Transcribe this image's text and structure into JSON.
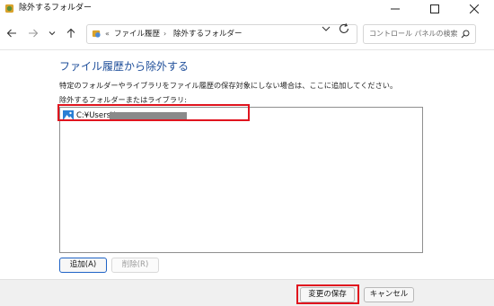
{
  "window": {
    "title": "除外するフォルダー",
    "controls": [
      "minimize-icon",
      "maximize-icon",
      "close-icon"
    ]
  },
  "addressbar": {
    "breadcrumb_overflow": "«",
    "crumbs": [
      "ファイル履歴",
      "除外するフォルダー"
    ],
    "separator": "›",
    "search_placeholder": "コントロール パネルの検索"
  },
  "main": {
    "heading": "ファイル履歴から除外する",
    "description": "特定のフォルダーやライブラリをファイル履歴の保存対象にしない場合は、ここに追加してください。",
    "list_label": "除外するフォルダーまたはライブラリ:",
    "items": [
      {
        "path": "C:¥Users¥",
        "icon": "folder-picture-icon",
        "masked": true
      }
    ],
    "add_button": "追加(A)",
    "remove_button": "削除(R)"
  },
  "footer": {
    "save_button": "変更の保存",
    "cancel_button": "キャンセル"
  },
  "colors": {
    "heading": "#1e4e9a",
    "highlight": "#e0141e",
    "footer_bg": "#f0f0f0"
  }
}
